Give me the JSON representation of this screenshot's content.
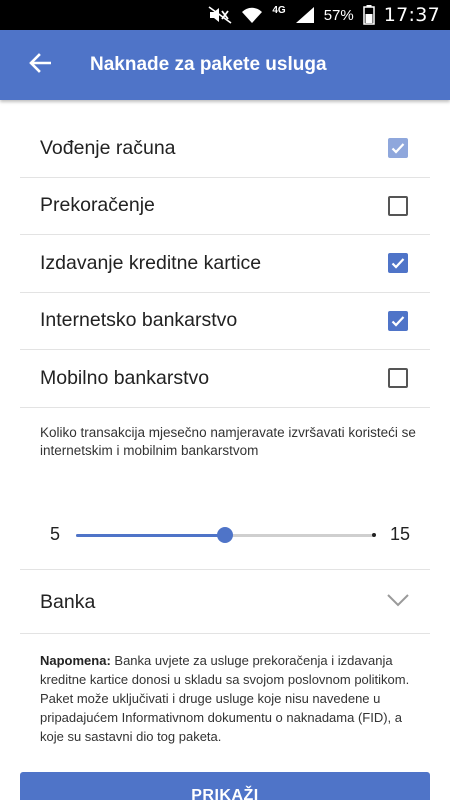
{
  "status_bar": {
    "battery_percent": "57%",
    "time": "17:37",
    "network": "4G",
    "icons": [
      "mute-icon",
      "wifi-icon",
      "signal-icon",
      "battery-icon"
    ]
  },
  "header": {
    "title": "Naknade za pakete usluga",
    "back_icon": "arrow-back-icon"
  },
  "services": [
    {
      "label": "Vođenje računa",
      "state": "checked-disabled"
    },
    {
      "label": "Prekoračenje",
      "state": "unchecked"
    },
    {
      "label": "Izdavanje kreditne kartice",
      "state": "checked"
    },
    {
      "label": "Internetsko bankarstvo",
      "state": "checked"
    },
    {
      "label": "Mobilno bankarstvo",
      "state": "unchecked"
    }
  ],
  "transactions": {
    "question": "Koliko transakcija mjesečno namjeravate izvršavati koristeći se internetskim i mobilnim bankarstvom",
    "min": "5",
    "max": "15",
    "value_fraction": 0.5
  },
  "bank_select": {
    "value": "Banka",
    "icon": "chevron-down-icon"
  },
  "note": {
    "label": "Napomena:",
    "text": " Banka uvjete za usluge prekoračenja i izdavanja kreditne kartice donosi u skladu sa svojom poslovnom politikom. Paket može uključivati i druge usluge koje nisu navedene u pripadajućem Informativnom dokumentu o naknadama (FID), a koje su sastavni dio tog paketa."
  },
  "submit_label": "PRIKAŽI",
  "colors": {
    "accent": "#4f74c8",
    "accent_disabled": "#8fa7dc",
    "divider": "#e3e3e3"
  }
}
